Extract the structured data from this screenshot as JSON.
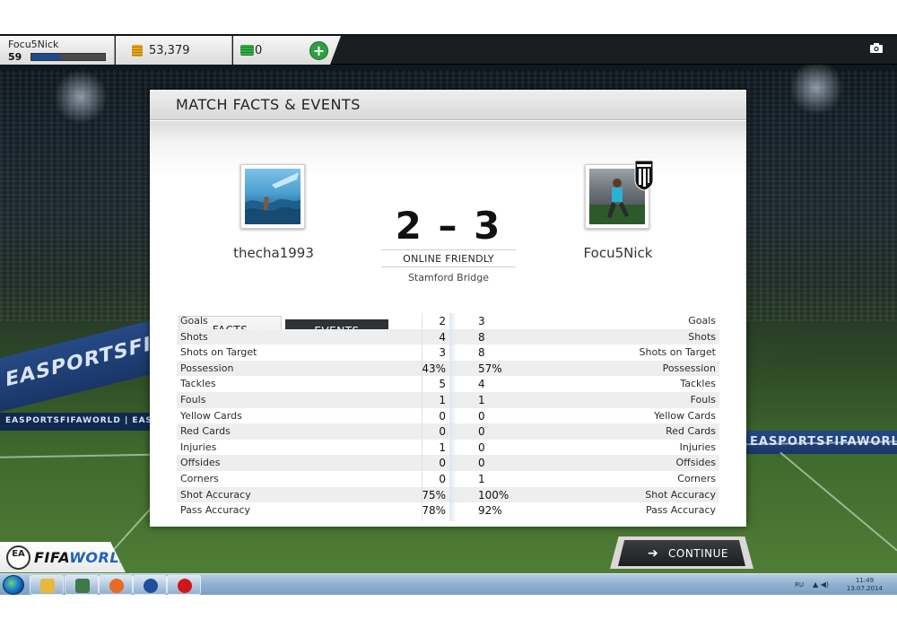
{
  "topbar": {
    "player_name": "Focu5Nick",
    "player_level": "59",
    "xp_progress": 0.4,
    "coins": "53,379",
    "fifa_cash": "0",
    "add_label": "+"
  },
  "panel": {
    "title": "MATCH FACTS & EVENTS",
    "home_team": "thecha1993",
    "away_team": "Focu5Nick",
    "score": "2 – 3",
    "match_type": "ONLINE FRIENDLY",
    "stadium": "Stamford Bridge",
    "tabs": [
      {
        "label": "FACTS",
        "active": true
      },
      {
        "label": "EVENTS",
        "active": false
      }
    ],
    "stats": [
      {
        "label": "Goals",
        "home": "2",
        "away": "3"
      },
      {
        "label": "Shots",
        "home": "4",
        "away": "8"
      },
      {
        "label": "Shots on Target",
        "home": "3",
        "away": "8"
      },
      {
        "label": "Possession",
        "home": "43%",
        "away": "57%"
      },
      {
        "label": "Tackles",
        "home": "5",
        "away": "4"
      },
      {
        "label": "Fouls",
        "home": "1",
        "away": "1"
      },
      {
        "label": "Yellow Cards",
        "home": "0",
        "away": "0"
      },
      {
        "label": "Red Cards",
        "home": "0",
        "away": "0"
      },
      {
        "label": "Injuries",
        "home": "1",
        "away": "0"
      },
      {
        "label": "Offsides",
        "home": "0",
        "away": "0"
      },
      {
        "label": "Corners",
        "home": "0",
        "away": "1"
      },
      {
        "label": "Shot Accuracy",
        "home": "75%",
        "away": "100%"
      },
      {
        "label": "Pass Accuracy",
        "home": "78%",
        "away": "92%"
      }
    ]
  },
  "continue_label": "CONTINUE",
  "logo": {
    "ea": "EA\nSPORTS",
    "fifa": "FIFA",
    "world": "WORLD"
  },
  "background_boards": {
    "left": "EASPORTSFIFAWORLD",
    "right": "EASPORTSFIFAWORLD",
    "left_strip": "EASPORTSFIFAWORLD | EASP"
  },
  "taskbar": {
    "language": "RU",
    "time": "11:49",
    "date": "13.07.2014"
  },
  "colors": {
    "accent_green": "#2ea043",
    "events_tab": "#303234",
    "logo_blue": "#1e63b8"
  }
}
